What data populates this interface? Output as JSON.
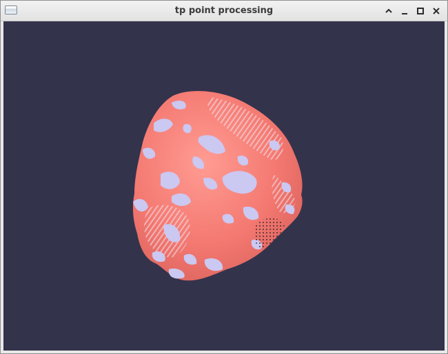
{
  "window": {
    "title": "tp point processing",
    "icon": "window-app-icon",
    "controls": [
      "maximize-up-icon",
      "minimize-icon",
      "maximize-icon",
      "close-icon"
    ]
  },
  "viewport": {
    "background_color": "#34334c",
    "model_color": "#f47a72",
    "highlight_color": "#c9c6f0"
  }
}
